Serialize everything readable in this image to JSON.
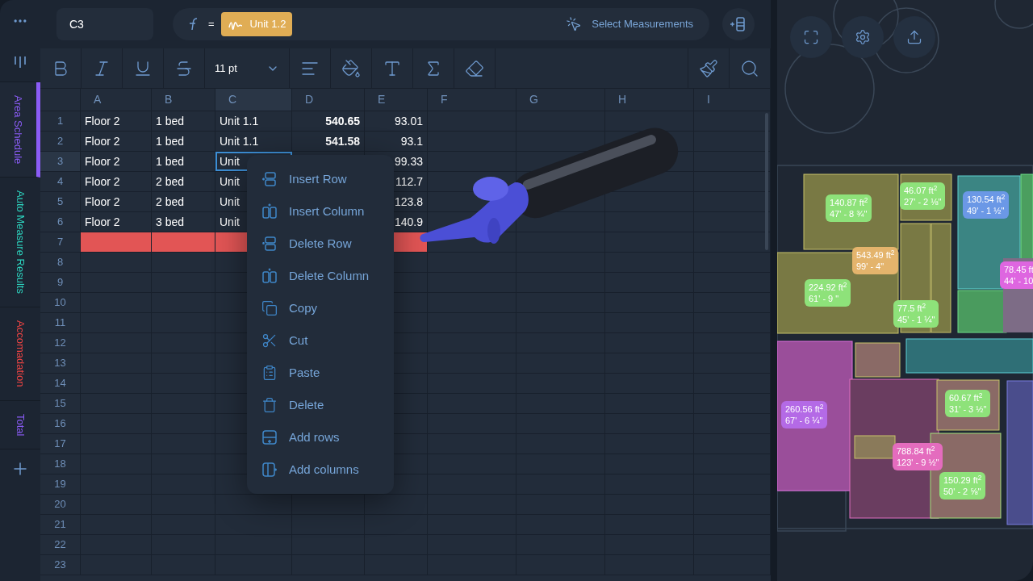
{
  "sidebar": {
    "tabs": [
      {
        "label": "Area Schedule",
        "selected": true,
        "color": "#8b5cf6"
      },
      {
        "label": "Auto Measure Results",
        "selected": false,
        "color": "#2dd4bf"
      },
      {
        "label": "Accomadation",
        "selected": false,
        "color": "#ef4444"
      },
      {
        "label": "Total",
        "selected": false,
        "color": "#8b5cf6"
      }
    ]
  },
  "formula_bar": {
    "cell_ref": "C3",
    "equals": "=",
    "chip": "Unit 1.2",
    "select_button": "Select Measurements"
  },
  "toolbar": {
    "font_size": "11 pt"
  },
  "sheet": {
    "columns": [
      {
        "label": "A",
        "selected": false
      },
      {
        "label": "B",
        "selected": false
      },
      {
        "label": "C",
        "selected": true
      },
      {
        "label": "D",
        "selected": false
      },
      {
        "label": "E",
        "selected": false
      },
      {
        "label": "F",
        "selected": false
      },
      {
        "label": "G",
        "selected": false
      },
      {
        "label": "H",
        "selected": false
      },
      {
        "label": "I",
        "selected": false
      }
    ],
    "rows": [
      {
        "number": "1",
        "selected": false,
        "highlighted": false,
        "cells": [
          "Floor 2",
          "1 bed",
          "Unit 1.1",
          "540.65",
          "93.01"
        ]
      },
      {
        "number": "2",
        "selected": false,
        "highlighted": false,
        "cells": [
          "Floor 2",
          "1 bed",
          "Unit 1.1",
          "541.58",
          "93.1"
        ]
      },
      {
        "number": "3",
        "selected": true,
        "highlighted": false,
        "cells": [
          "Floor 2",
          "1 bed",
          "Unit",
          null,
          "99.33"
        ]
      },
      {
        "number": "4",
        "selected": false,
        "highlighted": false,
        "cells": [
          "Floor 2",
          "2 bed",
          "Unit",
          null,
          "112.7"
        ]
      },
      {
        "number": "5",
        "selected": false,
        "highlighted": false,
        "cells": [
          "Floor 2",
          "2 bed",
          "Unit",
          null,
          "123.8"
        ]
      },
      {
        "number": "6",
        "selected": false,
        "highlighted": false,
        "cells": [
          "Floor 2",
          "3 bed",
          "Unit",
          null,
          "140.9"
        ]
      },
      {
        "number": "7",
        "selected": false,
        "highlighted": true
      },
      {
        "number": "8",
        "selected": false,
        "highlighted": false
      },
      {
        "number": "9",
        "selected": false,
        "highlighted": false
      },
      {
        "number": "10",
        "selected": false,
        "highlighted": false
      },
      {
        "number": "11",
        "selected": false,
        "highlighted": false
      },
      {
        "number": "12",
        "selected": false,
        "highlighted": false
      },
      {
        "number": "13",
        "selected": false,
        "highlighted": false
      },
      {
        "number": "14",
        "selected": false,
        "highlighted": false
      },
      {
        "number": "15",
        "selected": false,
        "highlighted": false
      },
      {
        "number": "16",
        "selected": false,
        "highlighted": false
      },
      {
        "number": "17",
        "selected": false,
        "highlighted": false
      },
      {
        "number": "18",
        "selected": false,
        "highlighted": false
      },
      {
        "number": "19",
        "selected": false,
        "highlighted": false
      },
      {
        "number": "20",
        "selected": false,
        "highlighted": false
      },
      {
        "number": "21",
        "selected": false,
        "highlighted": false
      },
      {
        "number": "22",
        "selected": false,
        "highlighted": false
      },
      {
        "number": "23",
        "selected": false,
        "highlighted": false
      }
    ]
  },
  "context_menu": {
    "items": [
      {
        "label": "Insert Row",
        "kind": "insert-row"
      },
      {
        "label": "Insert Column",
        "kind": "insert-column"
      },
      {
        "label": "Delete Row",
        "kind": "delete-row"
      },
      {
        "label": "Delete Column",
        "kind": "delete-column"
      },
      {
        "label": "Copy",
        "kind": "copy"
      },
      {
        "label": "Cut",
        "kind": "cut"
      },
      {
        "label": "Paste",
        "kind": "paste"
      },
      {
        "label": "Delete",
        "kind": "delete"
      },
      {
        "label": "Add rows",
        "kind": "add-rows"
      },
      {
        "label": "Add columns",
        "kind": "add-columns"
      }
    ]
  },
  "plan": {
    "labels": [
      {
        "area": "140.87 ft$^{2}$",
        "length": "47' -  8 ¾\"",
        "color": "#8ee27a"
      },
      {
        "area": "46.07 ft$^{2}$",
        "length": "27' -  2 ⅛\"",
        "color": "#8ee27a"
      },
      {
        "area": "130.54 ft$^{2}$",
        "length": "49' -  1 ½\"",
        "color": "#6b98e6"
      },
      {
        "area": "543.49 ft$^{2}$",
        "length": "99' -  4\"",
        "color": "#e4b46c"
      },
      {
        "area": "224.92 ft$^{2}$",
        "length": "61' -  9 \"",
        "color": "#8ee27a"
      },
      {
        "area": "77.5 ft$^{2}$",
        "length": "45' -  1 ¼\"",
        "color": "#8ee27a"
      },
      {
        "area": "78.45 ft",
        "length": "44' -  10",
        "color": "#de66e0"
      },
      {
        "area": "260.56 ft$^{2}$",
        "length": "67' -  6 ¼\"",
        "color": "#b46ae6"
      },
      {
        "area": "60.67 ft$^{2}$",
        "length": "31' -  3 ½\"",
        "color": "#8ee27a"
      },
      {
        "area": "788.84 ft$^{2}$",
        "length": "123' -  9 ½\"",
        "color": "#e46cbe"
      },
      {
        "area": "150.29 ft$^{2}$",
        "length": "50' -  2 ⅝\"",
        "color": "#8ee27a"
      }
    ]
  }
}
